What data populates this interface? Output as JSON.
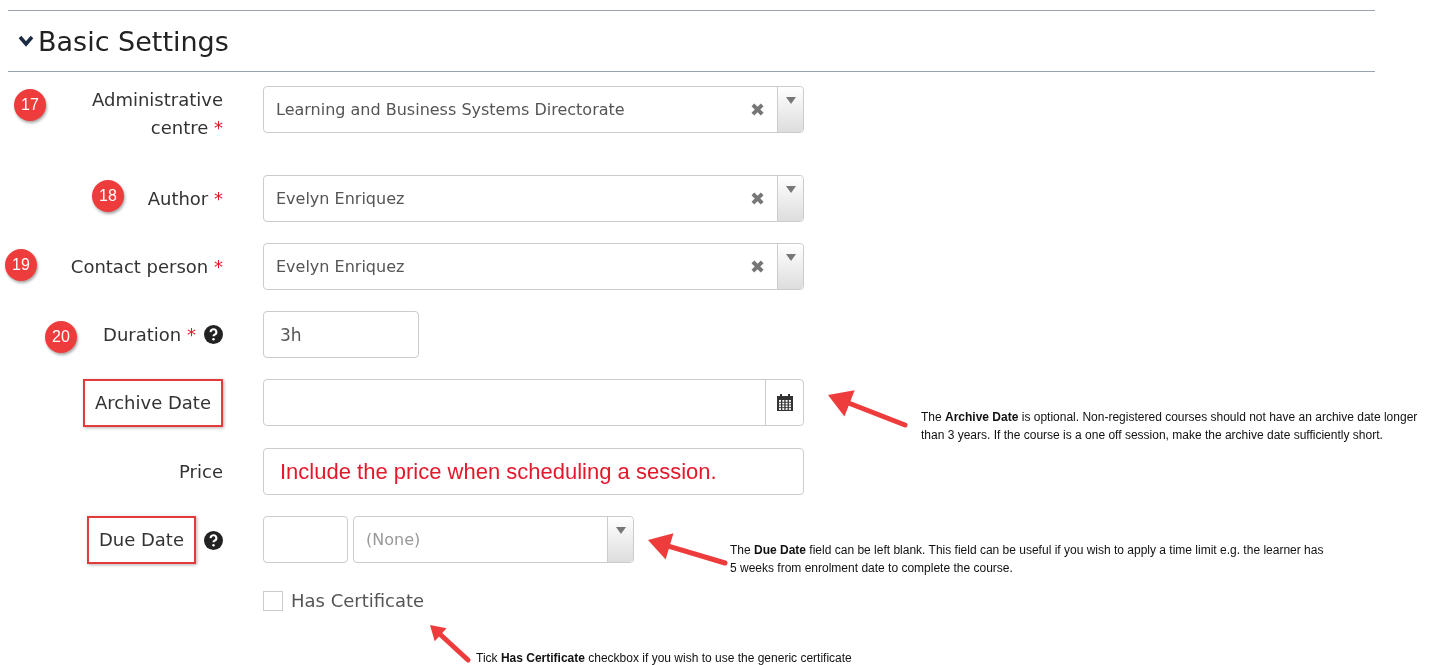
{
  "section": {
    "title": "Basic Settings",
    "expanded": true
  },
  "fields": [
    {
      "kind": "select",
      "label": "Administrative centre",
      "required_mark": "*",
      "badge": "17",
      "value": "Learning and Business Systems Directorate",
      "clear": "✖"
    },
    {
      "kind": "select",
      "label": "Author",
      "required_mark": "*",
      "badge": "18",
      "value": "Evelyn Enriquez",
      "clear": "✖"
    },
    {
      "kind": "select",
      "label": "Contact person",
      "required_mark": "*",
      "badge": "19",
      "value": "Evelyn Enriquez",
      "clear": "✖"
    },
    {
      "kind": "short",
      "label": "Duration",
      "required_mark": "*",
      "help": true,
      "badge": "20",
      "value": "3h"
    },
    {
      "kind": "date",
      "label": "Archive Date",
      "highlighted": true
    },
    {
      "kind": "notice",
      "label": "Price",
      "value": "Include the price when scheduling a session."
    },
    {
      "kind": "due",
      "label": "Due Date",
      "help": true,
      "highlighted": true,
      "placeholder": "(None)"
    }
  ],
  "checkbox": {
    "label": "Has Certificate",
    "checked": false
  },
  "notes": [
    {
      "text": "The **Archive Date** is optional. Non-registered courses should not have an archive date longer than 3 years. If the course is a one off session, make the archive date sufficiently short."
    },
    {
      "text": "The **Due Date** field can be left blank. This field can be useful if you wish to apply a time limit e.g. the learner has 5 weeks from enrolment date to complete the course."
    },
    {
      "text": "Tick **Has Certificate** checkbox if you wish to use the generic certificate"
    }
  ]
}
